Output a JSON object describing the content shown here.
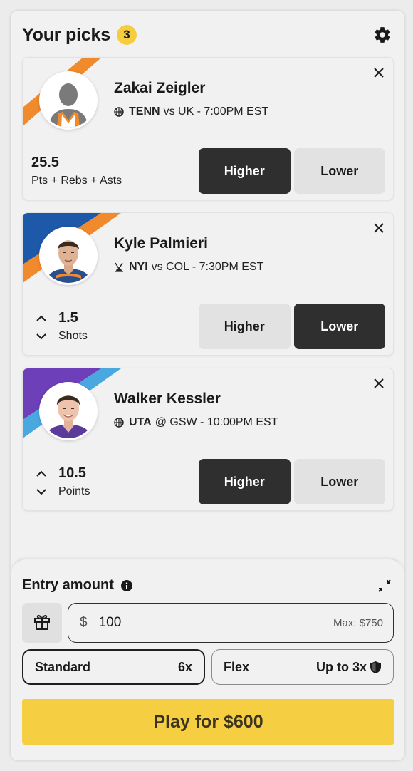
{
  "header": {
    "title": "Your picks",
    "count": "3"
  },
  "picks": [
    {
      "name": "Zakai Zeigler",
      "team": "TENN",
      "matchup": "vs UK - 7:00PM EST",
      "sport_icon": "basketball-icon",
      "value": "25.5",
      "stat": "Pts + Rebs + Asts",
      "higher_label": "Higher",
      "lower_label": "Lower",
      "selected": "higher",
      "stripe_colors": [
        "#f08a2c"
      ]
    },
    {
      "name": "Kyle Palmieri",
      "team": "NYI",
      "matchup": "vs COL - 7:30PM EST",
      "sport_icon": "hockey-icon",
      "value": "1.5",
      "stat": "Shots",
      "higher_label": "Higher",
      "lower_label": "Lower",
      "selected": "lower",
      "stripe_colors": [
        "#1e58a8",
        "#f08a2c"
      ]
    },
    {
      "name": "Walker Kessler",
      "team": "UTA",
      "matchup": "@ GSW - 10:00PM EST",
      "sport_icon": "basketball-icon",
      "value": "10.5",
      "stat": "Points",
      "higher_label": "Higher",
      "lower_label": "Lower",
      "selected": "higher",
      "stripe_colors": [
        "#6d3fb8",
        "#4aa8e0"
      ]
    }
  ],
  "entry": {
    "title": "Entry amount",
    "currency": "$",
    "amount": "100",
    "max": "Max: $750",
    "standard_label": "Standard",
    "standard_mult": "6x",
    "flex_label": "Flex",
    "flex_mult": "Up to 3x",
    "play_label": "Play for $600"
  },
  "colors": {
    "accent": "#f5cf41",
    "badge": "#f6cd3f",
    "selected": "#2f2f2f",
    "unselected": "#e2e2e2"
  }
}
